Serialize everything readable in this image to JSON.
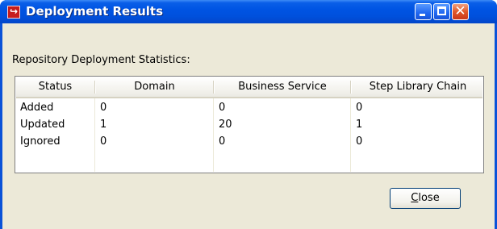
{
  "window": {
    "title": "Deployment Results",
    "app_icon_glyph": "↪"
  },
  "group": {
    "label": "Repository Deployment Statistics:"
  },
  "table": {
    "columns": [
      "Status",
      "Domain",
      "Business Service",
      "Step Library Chain"
    ],
    "rows": [
      [
        "Added",
        "0",
        "0",
        "0"
      ],
      [
        "Updated",
        "1",
        "20",
        "1"
      ],
      [
        "Ignored",
        "0",
        "0",
        "0"
      ]
    ]
  },
  "buttons": {
    "close_mnemonic": "C",
    "close_rest": "lose"
  },
  "colors": {
    "titlebar": "#0054e3",
    "dialog_bg": "#ece9d8",
    "close_button": "#e0582a"
  }
}
